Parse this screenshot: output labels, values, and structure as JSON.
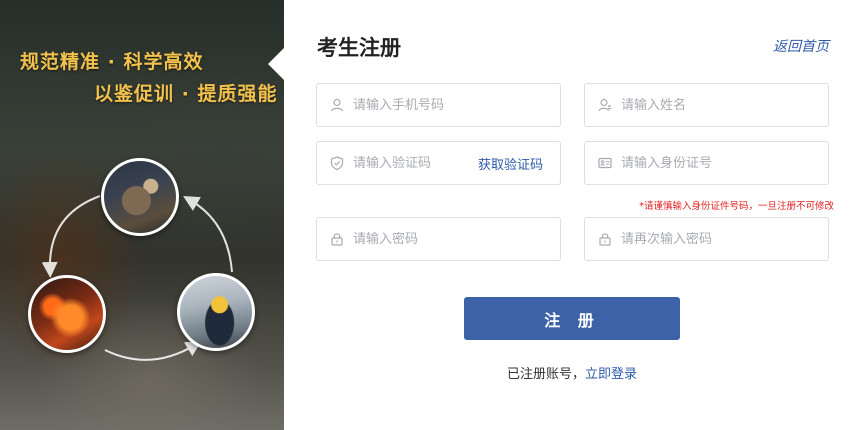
{
  "banner": {
    "slogan_line1": "规范精准 · 科学高效",
    "slogan_line2": "以鉴促训 · 提质强能"
  },
  "form": {
    "title": "考生注册",
    "back_home": "返回首页",
    "phone_placeholder": "请输入手机号码",
    "name_placeholder": "请输入姓名",
    "code_placeholder": "请输入验证码",
    "get_code": "获取验证码",
    "id_placeholder": "请输入身份证号",
    "id_hint": "*请谨慎输入身份证件号码，一旦注册不可修改",
    "password_placeholder": "请输入密码",
    "password_confirm_placeholder": "请再次输入密码",
    "submit_label": "注 册",
    "have_account": "已注册账号，",
    "login_now": "立即登录"
  },
  "colors": {
    "accent": "#3d62a8",
    "link": "#2f5aa8",
    "warning": "#e02020",
    "slogan": "#f3c24d"
  },
  "icons": {
    "phone": "user-icon",
    "name": "user-badge-icon",
    "code": "shield-check-icon",
    "id": "id-card-icon",
    "password": "lock-icon",
    "password_confirm": "lock-icon"
  }
}
